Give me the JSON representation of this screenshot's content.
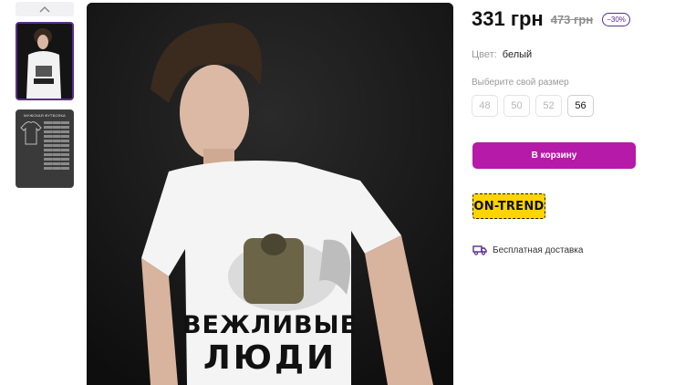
{
  "price": {
    "current": "331 грн",
    "old": "473 грн",
    "discount": "−30%"
  },
  "color": {
    "label": "Цвет:",
    "value": "белый"
  },
  "size": {
    "label": "Выберите свой размер",
    "options": [
      "48",
      "50",
      "52",
      "56"
    ],
    "selected": "56"
  },
  "cart": {
    "button_label": "В корзину"
  },
  "badge": {
    "text": "ON-TREND"
  },
  "delivery": {
    "text": "Бесплатная доставка",
    "icon": "delivery-truck-icon"
  },
  "product_image": {
    "print_line1": "ВЕЖЛИВЫЕ",
    "print_line2": "ЛЮДИ"
  },
  "thumbnails": {
    "size_chart_title": "МУЖСКАЯ ФУТБОЛКА"
  },
  "colors": {
    "accent": "#b61aa8",
    "discount": "#5b2c8f",
    "badge_bg": "#ffd400",
    "photo_bg": "#151515"
  }
}
